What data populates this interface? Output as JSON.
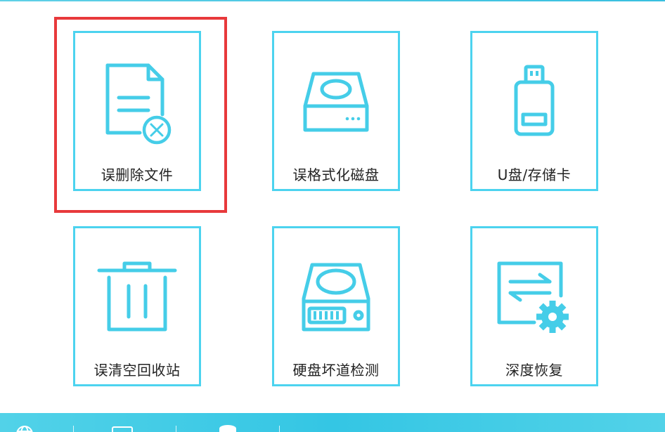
{
  "colors": {
    "tile_border": "#4cd3ef",
    "icon_stroke": "#45cde8",
    "selection_border": "#e8393b",
    "bottom_bar": "#3ec9e6"
  },
  "tiles": [
    {
      "label": "误删除文件",
      "icon": "deleted-file-icon",
      "selected": true
    },
    {
      "label": "误格式化磁盘",
      "icon": "disk-drive-icon"
    },
    {
      "label": "U盘/存储卡",
      "icon": "usb-drive-icon"
    },
    {
      "label": "误清空回收站",
      "icon": "recycle-bin-icon"
    },
    {
      "label": "硬盘坏道检测",
      "icon": "hard-disk-check-icon"
    },
    {
      "label": "深度恢复",
      "icon": "deep-recovery-icon"
    }
  ],
  "bottom_bar": {
    "icons": [
      "globe-icon",
      "monitor-icon",
      "database-icon"
    ]
  }
}
